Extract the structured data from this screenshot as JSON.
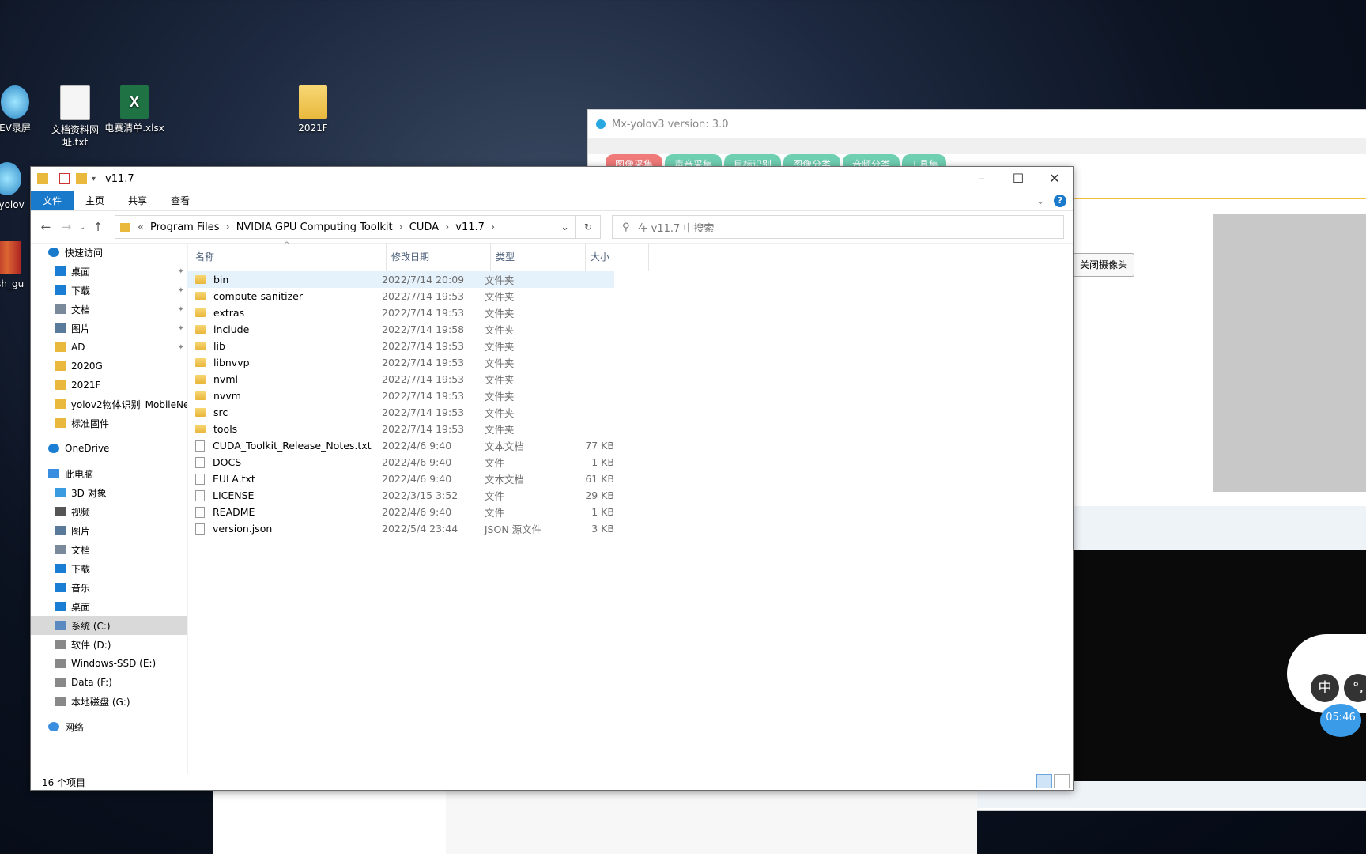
{
  "desktop": {
    "icons": [
      {
        "label": "EV录屏"
      },
      {
        "label": "文档资料网址.txt"
      },
      {
        "label": "电赛清单.xlsx"
      },
      {
        "label": "2021F"
      },
      {
        "label": "x-yolov"
      },
      {
        "label": "ash_gu"
      }
    ]
  },
  "bg_app": {
    "title": "Mx-yolov3 version: 3.0",
    "tabs": [
      "图像采集",
      "声音采集",
      "目标识别",
      "图像分类",
      "音频分类",
      "工具集"
    ],
    "tab_colors": [
      "#f07a7a",
      "#6fcfb1",
      "#6fcfb1",
      "#6fcfb1",
      "#6fcfb1",
      "#6fcfb1"
    ],
    "close_camera_label": "关闭摄像头",
    "ime": {
      "lang": "中",
      "punct": "°,"
    },
    "clock": "05:46"
  },
  "explorer": {
    "title": "v11.7",
    "ribbon_tabs": [
      "文件",
      "主页",
      "共享",
      "查看"
    ],
    "breadcrumb": [
      "Program Files",
      "NVIDIA GPU Computing Toolkit",
      "CUDA",
      "v11.7"
    ],
    "search_placeholder": "在 v11.7 中搜索",
    "nav": [
      {
        "label": "快速访问",
        "icon": "star-icon",
        "color": "#1979ca",
        "indent": 0,
        "pinned": false
      },
      {
        "label": "桌面",
        "icon": "desktop-icon",
        "color": "#1a7fd4",
        "indent": 1,
        "pinned": true
      },
      {
        "label": "下载",
        "icon": "download-icon",
        "color": "#1a7fd4",
        "indent": 1,
        "pinned": true
      },
      {
        "label": "文档",
        "icon": "documents-icon",
        "color": "#7a8a9a",
        "indent": 1,
        "pinned": true
      },
      {
        "label": "图片",
        "icon": "pictures-icon",
        "color": "#5a7a9a",
        "indent": 1,
        "pinned": true
      },
      {
        "label": "AD",
        "icon": "folder-icon",
        "color": "#e9b93d",
        "indent": 1,
        "pinned": true
      },
      {
        "label": "2020G",
        "icon": "folder-icon",
        "color": "#e9b93d",
        "indent": 1,
        "pinned": false
      },
      {
        "label": "2021F",
        "icon": "folder-icon",
        "color": "#e9b93d",
        "indent": 1,
        "pinned": false
      },
      {
        "label": "yolov2物体识别_MobileNe",
        "icon": "folder-icon",
        "color": "#e9b93d",
        "indent": 1,
        "pinned": false
      },
      {
        "label": "标准固件",
        "icon": "folder-icon",
        "color": "#e9b93d",
        "indent": 1,
        "pinned": false
      },
      {
        "label": "",
        "icon": "",
        "color": "",
        "indent": 0,
        "pinned": false
      },
      {
        "label": "OneDrive",
        "icon": "cloud-icon",
        "color": "#1a7fd4",
        "indent": 0,
        "pinned": false
      },
      {
        "label": "",
        "icon": "",
        "color": "",
        "indent": 0,
        "pinned": false
      },
      {
        "label": "此电脑",
        "icon": "computer-icon",
        "color": "#3a8ee0",
        "indent": 0,
        "pinned": false
      },
      {
        "label": "3D 对象",
        "icon": "cube-icon",
        "color": "#3a9be0",
        "indent": 1,
        "pinned": false
      },
      {
        "label": "视频",
        "icon": "video-icon",
        "color": "#555",
        "indent": 1,
        "pinned": false
      },
      {
        "label": "图片",
        "icon": "pictures-icon",
        "color": "#5a7a9a",
        "indent": 1,
        "pinned": false
      },
      {
        "label": "文档",
        "icon": "documents-icon",
        "color": "#7a8a9a",
        "indent": 1,
        "pinned": false
      },
      {
        "label": "下载",
        "icon": "download-icon",
        "color": "#1a7fd4",
        "indent": 1,
        "pinned": false
      },
      {
        "label": "音乐",
        "icon": "music-icon",
        "color": "#1a7fd4",
        "indent": 1,
        "pinned": false
      },
      {
        "label": "桌面",
        "icon": "desktop-icon",
        "color": "#1a7fd4",
        "indent": 1,
        "pinned": false
      },
      {
        "label": "系统 (C:)",
        "icon": "drive-icon",
        "color": "#5a8ac0",
        "indent": 1,
        "pinned": false,
        "selected": true
      },
      {
        "label": "软件 (D:)",
        "icon": "drive-icon",
        "color": "#888",
        "indent": 1,
        "pinned": false
      },
      {
        "label": "Windows-SSD (E:)",
        "icon": "drive-icon",
        "color": "#888",
        "indent": 1,
        "pinned": false
      },
      {
        "label": "Data (F:)",
        "icon": "drive-icon",
        "color": "#888",
        "indent": 1,
        "pinned": false
      },
      {
        "label": "本地磁盘 (G:)",
        "icon": "drive-icon",
        "color": "#888",
        "indent": 1,
        "pinned": false
      },
      {
        "label": "",
        "icon": "",
        "color": "",
        "indent": 0,
        "pinned": false
      },
      {
        "label": "网络",
        "icon": "network-icon",
        "color": "#3a8ee0",
        "indent": 0,
        "pinned": false
      }
    ],
    "columns": [
      "名称",
      "修改日期",
      "类型",
      "大小"
    ],
    "files": [
      {
        "name": "bin",
        "date": "2022/7/14 20:09",
        "type": "文件夹",
        "size": "",
        "kind": "folder",
        "selected": true
      },
      {
        "name": "compute-sanitizer",
        "date": "2022/7/14 19:53",
        "type": "文件夹",
        "size": "",
        "kind": "folder"
      },
      {
        "name": "extras",
        "date": "2022/7/14 19:53",
        "type": "文件夹",
        "size": "",
        "kind": "folder"
      },
      {
        "name": "include",
        "date": "2022/7/14 19:58",
        "type": "文件夹",
        "size": "",
        "kind": "folder"
      },
      {
        "name": "lib",
        "date": "2022/7/14 19:53",
        "type": "文件夹",
        "size": "",
        "kind": "folder"
      },
      {
        "name": "libnvvp",
        "date": "2022/7/14 19:53",
        "type": "文件夹",
        "size": "",
        "kind": "folder"
      },
      {
        "name": "nvml",
        "date": "2022/7/14 19:53",
        "type": "文件夹",
        "size": "",
        "kind": "folder"
      },
      {
        "name": "nvvm",
        "date": "2022/7/14 19:53",
        "type": "文件夹",
        "size": "",
        "kind": "folder"
      },
      {
        "name": "src",
        "date": "2022/7/14 19:53",
        "type": "文件夹",
        "size": "",
        "kind": "folder"
      },
      {
        "name": "tools",
        "date": "2022/7/14 19:53",
        "type": "文件夹",
        "size": "",
        "kind": "folder"
      },
      {
        "name": "CUDA_Toolkit_Release_Notes.txt",
        "date": "2022/4/6 9:40",
        "type": "文本文档",
        "size": "77 KB",
        "kind": "file"
      },
      {
        "name": "DOCS",
        "date": "2022/4/6 9:40",
        "type": "文件",
        "size": "1 KB",
        "kind": "file"
      },
      {
        "name": "EULA.txt",
        "date": "2022/4/6 9:40",
        "type": "文本文档",
        "size": "61 KB",
        "kind": "file"
      },
      {
        "name": "LICENSE",
        "date": "2022/3/15 3:52",
        "type": "文件",
        "size": "29 KB",
        "kind": "file"
      },
      {
        "name": "README",
        "date": "2022/4/6 9:40",
        "type": "文件",
        "size": "1 KB",
        "kind": "file"
      },
      {
        "name": "version.json",
        "date": "2022/5/4 23:44",
        "type": "JSON 源文件",
        "size": "3 KB",
        "kind": "file"
      }
    ],
    "status": "16 个项目"
  }
}
